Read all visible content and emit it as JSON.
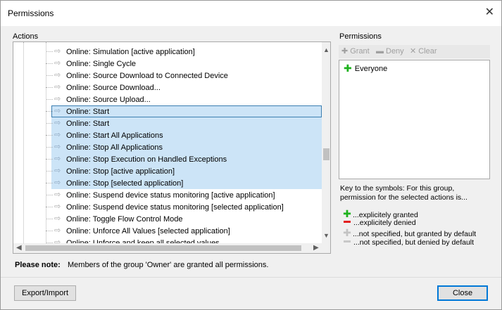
{
  "window": {
    "title": "Permissions",
    "close_glyph": "✕"
  },
  "actions": {
    "label": "Actions",
    "items": [
      {
        "label": "Online: Simulation [active application]",
        "selected": false
      },
      {
        "label": "Online: Single Cycle",
        "selected": false
      },
      {
        "label": "Online: Source Download to Connected Device",
        "selected": false
      },
      {
        "label": "Online: Source Download...",
        "selected": false
      },
      {
        "label": "Online: Source Upload...",
        "selected": false
      },
      {
        "label": "Online: Start",
        "selected": true,
        "focused": true
      },
      {
        "label": "Online: Start",
        "selected": true
      },
      {
        "label": "Online: Start All Applications",
        "selected": true
      },
      {
        "label": "Online: Stop All Applications",
        "selected": true
      },
      {
        "label": "Online: Stop Execution on Handled Exceptions",
        "selected": true
      },
      {
        "label": "Online: Stop [active application]",
        "selected": true
      },
      {
        "label": "Online: Stop [selected application]",
        "selected": true
      },
      {
        "label": "Online: Suspend device status monitoring [active application]",
        "selected": false
      },
      {
        "label": "Online: Suspend device status monitoring [selected application]",
        "selected": false
      },
      {
        "label": "Online: Toggle Flow Control Mode",
        "selected": false
      },
      {
        "label": "Online: Unforce All Values [selected application]",
        "selected": false
      },
      {
        "label": "Online: Unforce and keep all selected values",
        "selected": false
      }
    ]
  },
  "permissions": {
    "label": "Permissions",
    "toolbar": {
      "grant": "Grant",
      "deny": "Deny",
      "clear": "Clear"
    },
    "entries": [
      {
        "label": "Everyone",
        "state": "granted"
      }
    ],
    "key_text": "Key to the symbols: For this group, permission for the selected actions is...",
    "legend": {
      "granted": "...explicitely granted",
      "denied": "...explicitely denied",
      "default_granted": "...not specified, but granted by default",
      "default_denied": "...not specified, but denied by default"
    }
  },
  "note": {
    "label": "Please note:",
    "text": "Members of the group 'Owner' are granted all permissions."
  },
  "buttons": {
    "export_import": "Export/Import",
    "close": "Close"
  },
  "colors": {
    "selection": "#cce4f7",
    "granted": "#1db21d",
    "denied": "#e31e1e",
    "default_button_border": "#0078d7"
  },
  "icons": {
    "action_item": "arrow-right-icon",
    "grant": "plus-icon",
    "deny": "minus-icon",
    "clear": "x-icon"
  }
}
